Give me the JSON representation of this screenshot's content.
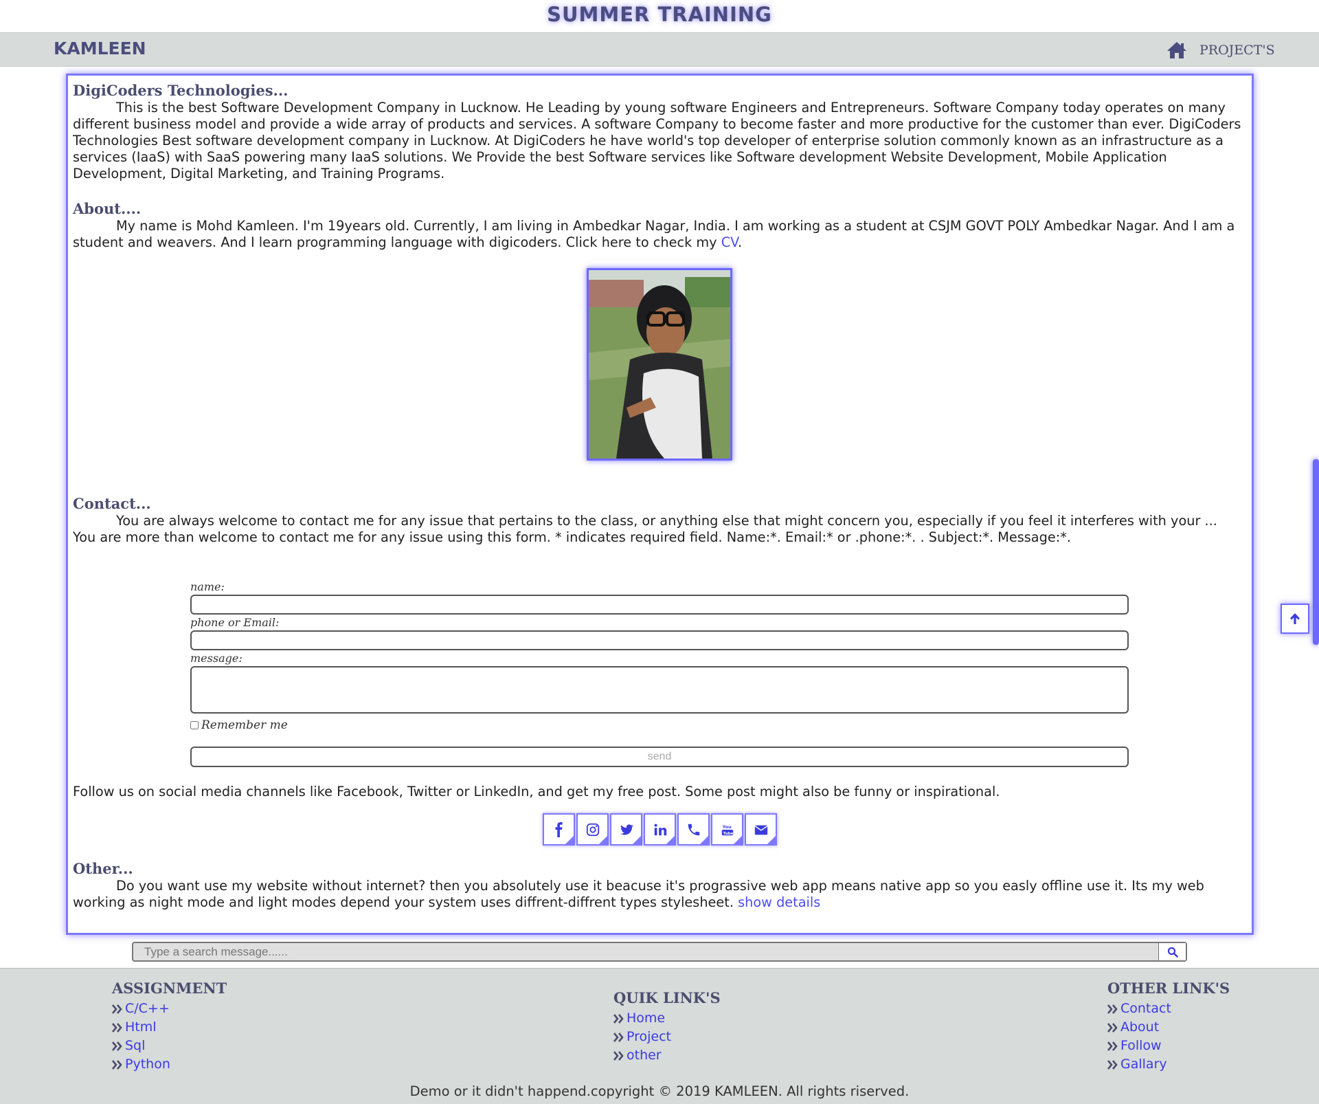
{
  "header": {
    "title": "SUMMER TRAINING"
  },
  "navbar": {
    "brand": "KAMLEEN",
    "home_icon": "home-icon",
    "projects": "PROJECT'S"
  },
  "sections": {
    "digicoders": {
      "title": "DigiCoders Technologies...",
      "text": "This is the best Software Development Company in Lucknow. He Leading by young software Engineers and Entrepreneurs. Software Company today operates on many different business model and provide a wide array of products and services. A software Company to become faster and more productive for the customer than ever. DigiCoders Technologies Best software development company in Lucknow. At DigiCoders he have world's top developer of enterprise solution commonly known as an infrastructure as a services (IaaS) with SaaS powering many IaaS solutions. We Provide the best Software services like Software development Website Development, Mobile Application Development, Digital Marketing, and Training Programs."
    },
    "about": {
      "title": "About....",
      "text": "My name is Mohd Kamleen. I'm 19years old. Currently, I am living in Ambedkar Nagar, India. I am working as a student at CSJM GOVT POLY Ambedkar Nagar. And I am a student and weavers. And I learn programming language with digicoders. Click here to check my",
      "link": "CV",
      "end": "."
    },
    "contact": {
      "title": "Contact...",
      "text": "You are always welcome to contact me for any issue that pertains to the class, or anything else that might concern you, especially if you feel it interferes with your ... You are more than welcome to contact me for any issue using this form. * indicates required field. Name:*. Email:* or .phone:*. . Subject:*. Message:*."
    },
    "other": {
      "title": "Other...",
      "text": "Do you want use my website without internet? then you absolutely use it beacuse it's prograssive web app means native app so you easly offline use it. Its my web working as night mode and light modes depend your system uses diffrent-diffrent types stylesheet.",
      "link": "show details"
    }
  },
  "form": {
    "name_label": "name:",
    "contact_label": "phone or Email:",
    "message_label": "message:",
    "remember_label": "Remember me",
    "send_label": "send"
  },
  "social": {
    "text": "Follow us on social media channels like Facebook, Twitter or LinkedIn, and get my free post. Some post might also be funny or inspirational.",
    "icons": [
      "facebook-icon",
      "instagram-icon",
      "twitter-icon",
      "linkedin-icon",
      "phone-icon",
      "youtube-icon",
      "envelope-icon"
    ]
  },
  "search": {
    "placeholder": "Type a search message......"
  },
  "colors": {
    "accent": "#7e78ff",
    "link": "#4c4cf0",
    "heading": "#4b4d6e",
    "navbar_bg": "#d7dbd9"
  },
  "footer": {
    "assignment": {
      "title": "ASSIGNMENT",
      "items": [
        "C/C++",
        "Html",
        "Sql",
        "Python"
      ]
    },
    "quick": {
      "title": "QUIK LINK'S",
      "items": [
        "Home",
        "Project",
        "other"
      ]
    },
    "other": {
      "title": "OTHER LINK'S",
      "items": [
        "Contact",
        "About",
        "Follow",
        "Gallary"
      ]
    },
    "copyright": "Demo or it didn't happend.copyright © 2019 KAMLEEN. All rights riserved."
  }
}
